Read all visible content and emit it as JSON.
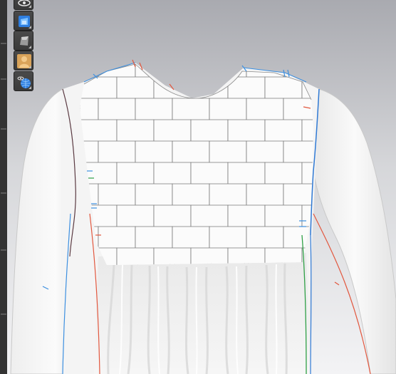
{
  "app": {
    "view": "3d-garment-viewport"
  },
  "toolbar": {
    "tools": [
      {
        "name": "visibility-toggle",
        "icon": "eye-icon"
      },
      {
        "name": "avatar-display",
        "icon": "avatar-blue-icon"
      },
      {
        "name": "texture-surface",
        "icon": "surface-icon"
      },
      {
        "name": "avatar-skin",
        "icon": "person-icon"
      },
      {
        "name": "environment-display",
        "icon": "eye-globe-icon"
      }
    ]
  },
  "colors": {
    "background_top": "#a9aab0",
    "background_bottom": "#f3f3f5",
    "garment": "#f7f7f7",
    "outline_left": "#3c8fe0",
    "outline_right": "#2f79d4",
    "seam_red": "#e2573e",
    "seam_green": "#2fa046",
    "seam_dark": "#5a3a42"
  }
}
